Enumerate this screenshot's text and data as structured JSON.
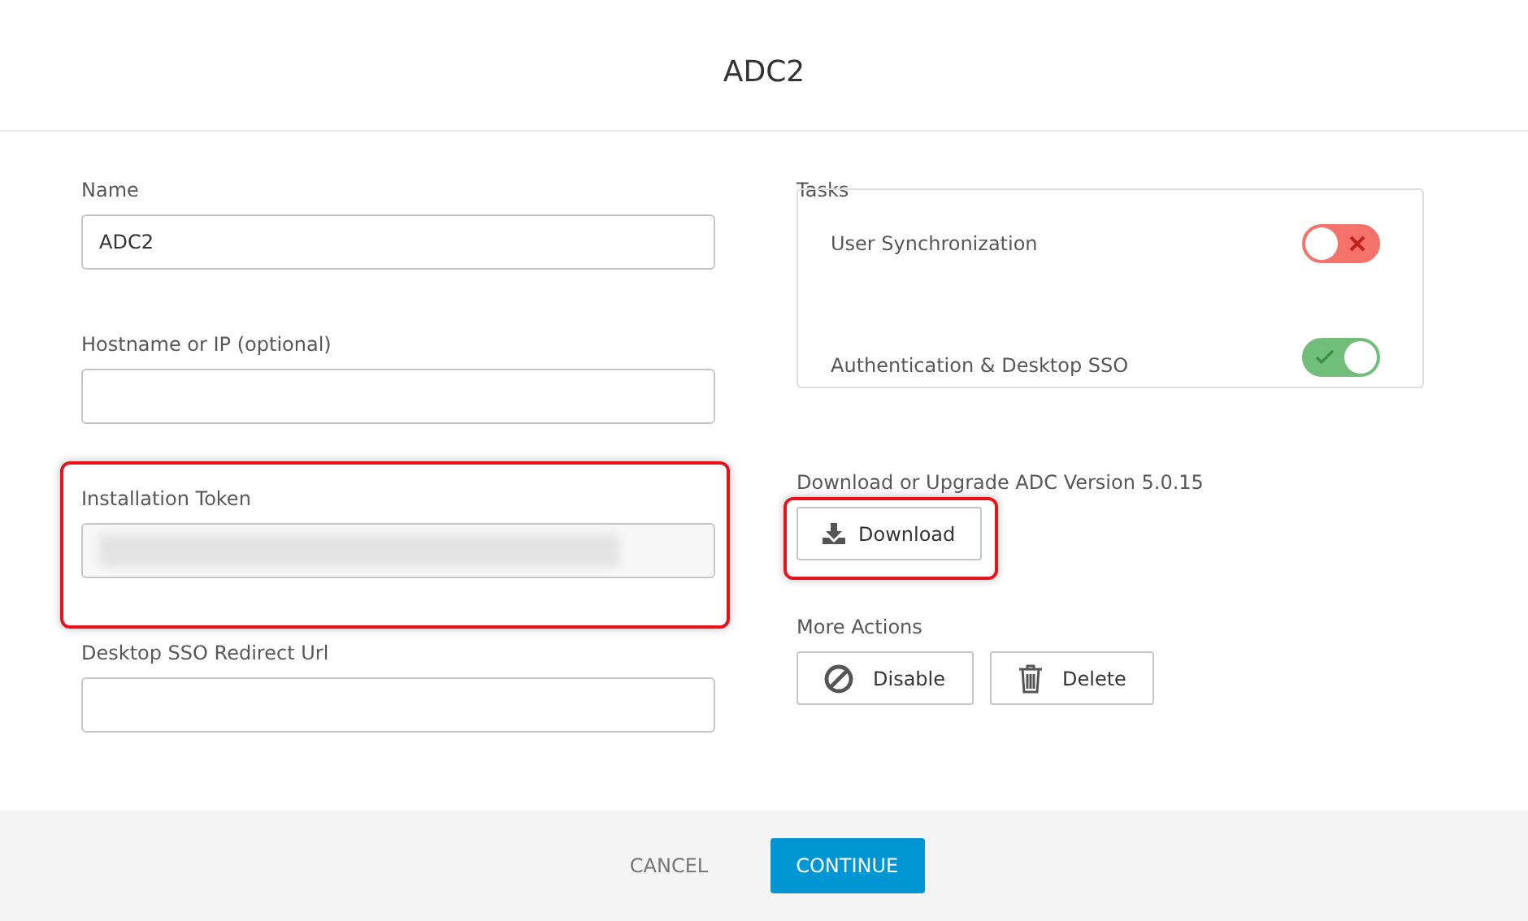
{
  "dialog": {
    "title": "ADC2"
  },
  "fields": [
    {
      "label": "Name",
      "value": "ADC2",
      "redacted": false,
      "highlighted": false
    },
    {
      "label": "Hostname or IP (optional)",
      "redacted": false,
      "highlighted": false
    },
    {
      "label": "Installation Token",
      "redacted": true,
      "highlighted": true
    },
    {
      "label": "Desktop SSO Redirect Url",
      "redacted": false,
      "highlighted": false
    }
  ],
  "tasks": {
    "label": "Tasks",
    "items": [
      {
        "label": "User Synchronization",
        "on": false
      },
      {
        "label": "Authentication & Desktop SSO",
        "on": true
      }
    ]
  },
  "download": {
    "label": "Download or Upgrade ADC Version 5.0.15",
    "button": "Download",
    "highlighted": true
  },
  "more_actions": {
    "label": "More Actions",
    "buttons": [
      {
        "kind": "disable",
        "label": "Disable"
      },
      {
        "kind": "delete",
        "label": "Delete"
      }
    ]
  },
  "footer": {
    "buttons": [
      {
        "label": "CANCEL",
        "kind": "secondary"
      },
      {
        "label": "CONTINUE",
        "kind": "primary"
      }
    ]
  }
}
